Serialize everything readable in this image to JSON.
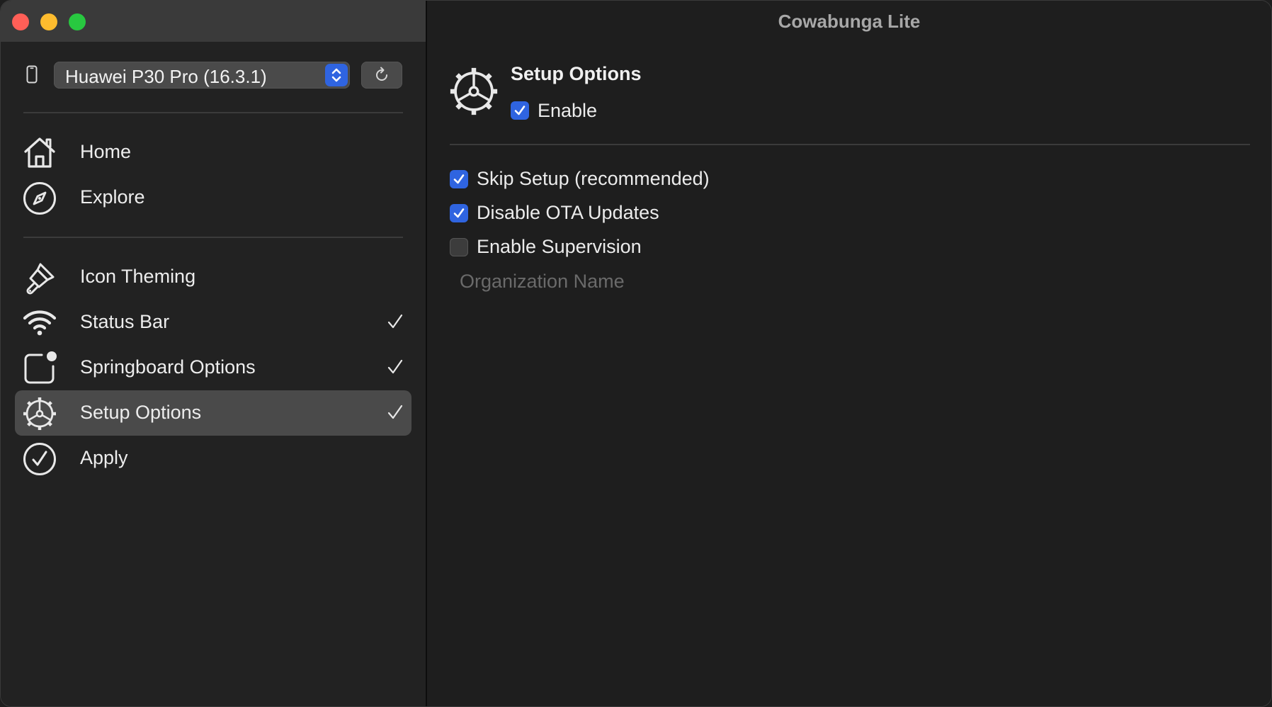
{
  "window": {
    "title": "Cowabunga Lite"
  },
  "device": {
    "selected": "Huawei P30 Pro (16.3.1)"
  },
  "sidebar": {
    "items": [
      {
        "label": "Home",
        "icon": "house-icon",
        "checked": false
      },
      {
        "label": "Explore",
        "icon": "compass-icon",
        "checked": false
      },
      {
        "label": "Icon Theming",
        "icon": "paintbrush-icon",
        "checked": false
      },
      {
        "label": "Status Bar",
        "icon": "wifi-icon",
        "checked": true
      },
      {
        "label": "Springboard Options",
        "icon": "app-badge-icon",
        "checked": true
      },
      {
        "label": "Setup Options",
        "icon": "gear-icon",
        "checked": true,
        "selected": true
      },
      {
        "label": "Apply",
        "icon": "checkmark-circle-icon",
        "checked": false
      }
    ]
  },
  "main": {
    "title": "Setup Options",
    "enable": {
      "label": "Enable",
      "checked": true
    },
    "options": [
      {
        "label": "Skip Setup (recommended)",
        "checked": true
      },
      {
        "label": "Disable OTA Updates",
        "checked": true
      },
      {
        "label": "Enable Supervision",
        "checked": false
      }
    ],
    "organization": {
      "placeholder": "Organization Name",
      "value": ""
    }
  },
  "colors": {
    "accent": "#2f64e0",
    "close": "#ff5f57",
    "minimize": "#febc2e",
    "maximize": "#28c840"
  }
}
